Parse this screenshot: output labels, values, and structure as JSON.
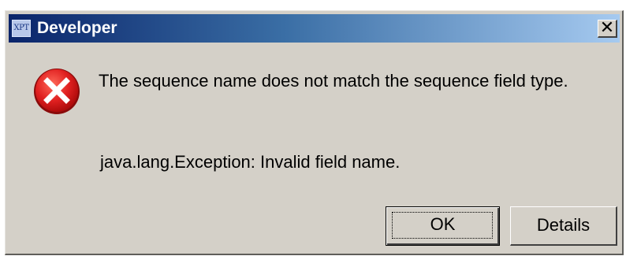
{
  "window": {
    "title": "Developer",
    "app_icon_text": "XPT",
    "close_glyph": "✕"
  },
  "dialog": {
    "icon": "error-icon",
    "message": "The sequence name does not match the sequence field type.",
    "exception": "java.lang.Exception: Invalid field name."
  },
  "buttons": {
    "ok_label": "OK",
    "details_label": "Details"
  },
  "colors": {
    "titlebar_start": "#0a246a",
    "titlebar_end": "#a6caf0",
    "dialog_background": "#d4d0c8",
    "error_red": "#e02020"
  }
}
